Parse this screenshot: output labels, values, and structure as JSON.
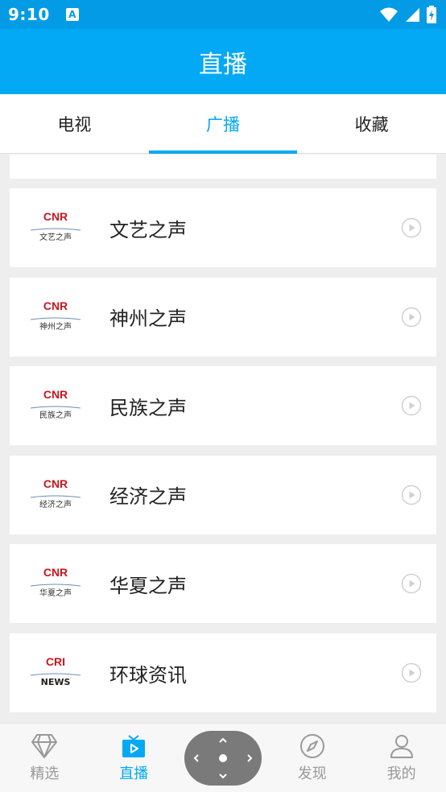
{
  "status": {
    "time": "9:10",
    "a_badge": "A"
  },
  "appbar": {
    "title": "直播"
  },
  "tabs": [
    {
      "label": "电视",
      "active": false
    },
    {
      "label": "广播",
      "active": true
    },
    {
      "label": "收藏",
      "active": false
    }
  ],
  "stations": [
    {
      "name": "文艺之声",
      "logo_icon": "cnr-wenyi-logo",
      "logo_brand": "CNR",
      "logo_sub": "文艺之声"
    },
    {
      "name": "神州之声",
      "logo_icon": "cnr-shenzhou-logo",
      "logo_brand": "CNR",
      "logo_sub": "神州之声"
    },
    {
      "name": "民族之声",
      "logo_icon": "cnr-minzu-logo",
      "logo_brand": "CNR",
      "logo_sub": "民族之声"
    },
    {
      "name": "经济之声",
      "logo_icon": "cnr-jingji-logo",
      "logo_brand": "CNR",
      "logo_sub": "经济之声"
    },
    {
      "name": "华夏之声",
      "logo_icon": "cnr-huaxia-logo",
      "logo_brand": "CNR",
      "logo_sub": "华夏之声"
    },
    {
      "name": "环球资讯",
      "logo_icon": "cri-news-logo",
      "logo_brand": "CRI",
      "logo_sub": "NEWS"
    }
  ],
  "bottom_nav": [
    {
      "label": "精选",
      "icon": "diamond-icon",
      "active": false
    },
    {
      "label": "直播",
      "icon": "tv-icon",
      "active": true
    },
    {
      "label": "",
      "icon": "dpad-icon",
      "active": false
    },
    {
      "label": "发现",
      "icon": "compass-icon",
      "active": false
    },
    {
      "label": "我的",
      "icon": "user-icon",
      "active": false
    }
  ],
  "colors": {
    "primary": "#03a9f4",
    "status_bar": "#039be5",
    "cnr_red": "#c8161d",
    "background": "#eeeeee"
  }
}
